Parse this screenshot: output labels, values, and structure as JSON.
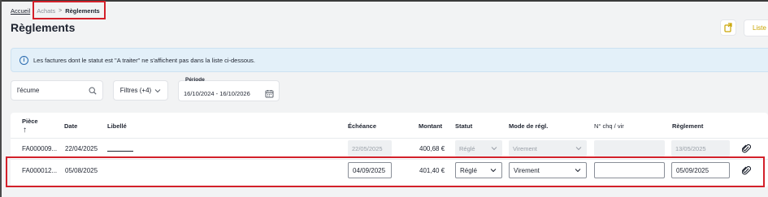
{
  "breadcrumb": {
    "home": "Accueil",
    "purchases": "Achats",
    "separator": ">",
    "current": "Règlements"
  },
  "page": {
    "title": "Règlements"
  },
  "header_actions": {
    "list_label": "Liste"
  },
  "info_banner": {
    "text": "Les factures dont le statut est \"A traiter\" ne s'affichent pas dans la liste ci-dessous."
  },
  "search": {
    "value": "l'écume"
  },
  "filters": {
    "label": "Filtres (+4)"
  },
  "period": {
    "label": "Période",
    "value": "16/10/2024 - 16/10/2026"
  },
  "table": {
    "headers": {
      "piece": "Pièce",
      "sort_arrow": "↑",
      "date": "Date",
      "libelle": "Libellé",
      "echeance": "Échéance",
      "montant": "Montant",
      "statut": "Statut",
      "mode": "Mode de régl.",
      "cheque": "N° chq / vir",
      "reglement": "Règlement"
    },
    "rows": [
      {
        "piece": "FA000009...",
        "date": "22/04/2025",
        "echeance": "22/05/2025",
        "montant": "400,68 €",
        "statut": "Réglé",
        "mode": "Virement",
        "cheque": "",
        "reglement": "13/05/2025",
        "editable": false
      },
      {
        "piece": "FA000012...",
        "date": "05/08/2025",
        "echeance": "04/09/2025",
        "montant": "401,40 €",
        "statut": "Réglé",
        "mode": "Virement",
        "cheque": "",
        "reglement": "05/09/2025",
        "editable": true
      }
    ]
  },
  "colors": {
    "accent": "#c9a400",
    "highlight": "#d3202a",
    "info_bg": "#e3f0f9",
    "info_icon": "#2b6cb0"
  },
  "icons": [
    "search-icon",
    "chevron-down-icon",
    "calendar-icon",
    "export-icon",
    "info-icon",
    "paperclip-icon"
  ]
}
